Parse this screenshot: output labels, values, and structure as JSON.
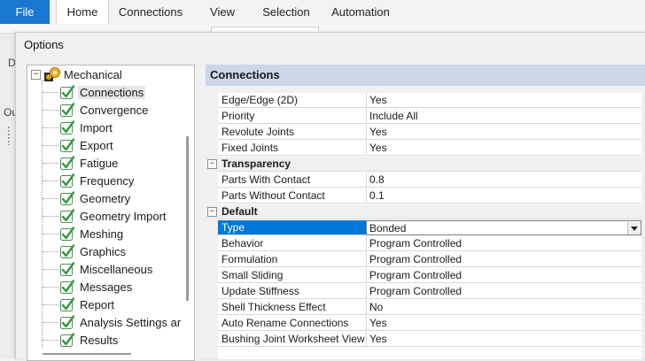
{
  "ribbon": {
    "file_label": "File",
    "tabs": [
      {
        "label": "Home",
        "active": true
      },
      {
        "label": "Connections",
        "active": false
      },
      {
        "label": "View",
        "active": false
      },
      {
        "label": "Selection",
        "active": false
      },
      {
        "label": "Automation",
        "active": false
      }
    ]
  },
  "background": {
    "left_letter_1": "D",
    "left_letter_2": "Ou"
  },
  "dialog": {
    "title": "Options"
  },
  "tree": {
    "root_label": "Mechanical",
    "root_expander": "−",
    "items": [
      {
        "label": "Connections",
        "selected": true
      },
      {
        "label": "Convergence"
      },
      {
        "label": "Import"
      },
      {
        "label": "Export"
      },
      {
        "label": "Fatigue"
      },
      {
        "label": "Frequency"
      },
      {
        "label": "Geometry"
      },
      {
        "label": "Geometry Import"
      },
      {
        "label": "Meshing"
      },
      {
        "label": "Graphics"
      },
      {
        "label": "Miscellaneous"
      },
      {
        "label": "Messages"
      },
      {
        "label": "Report"
      },
      {
        "label": "Analysis Settings ar"
      },
      {
        "label": "Results"
      }
    ]
  },
  "properties": {
    "header": "Connections",
    "rows": [
      {
        "kind": "prop",
        "name": "Edge/Edge (2D)",
        "value": "Yes"
      },
      {
        "kind": "prop",
        "name": "Priority",
        "value": "Include All"
      },
      {
        "kind": "prop",
        "name": "Revolute Joints",
        "value": "Yes"
      },
      {
        "kind": "prop",
        "name": "Fixed Joints",
        "value": "Yes"
      },
      {
        "kind": "category",
        "name": "Transparency",
        "expander": "−"
      },
      {
        "kind": "prop",
        "name": "Parts With Contact",
        "value": "0.8"
      },
      {
        "kind": "prop",
        "name": "Parts Without Contact",
        "value": "0.1"
      },
      {
        "kind": "category",
        "name": "Default",
        "expander": "−"
      },
      {
        "kind": "prop",
        "name": "Type",
        "value": "Bonded",
        "selected": true,
        "dropdown": true
      },
      {
        "kind": "prop",
        "name": "Behavior",
        "value": "Program Controlled"
      },
      {
        "kind": "prop",
        "name": "Formulation",
        "value": "Program Controlled"
      },
      {
        "kind": "prop",
        "name": "Small Sliding",
        "value": "Program Controlled"
      },
      {
        "kind": "prop",
        "name": "Update Stiffness",
        "value": "Program Controlled"
      },
      {
        "kind": "prop",
        "name": "Shell Thickness Effect",
        "value": "No"
      },
      {
        "kind": "prop",
        "name": "Auto Rename Connections",
        "value": "Yes"
      },
      {
        "kind": "prop",
        "name": "Bushing Joint Worksheet View",
        "value": "Yes"
      }
    ]
  },
  "colors": {
    "file_tab": "#1977d2",
    "header_band": "#c9d7e9",
    "selection": "#0078d7",
    "check_green": "#2e9a3c"
  }
}
